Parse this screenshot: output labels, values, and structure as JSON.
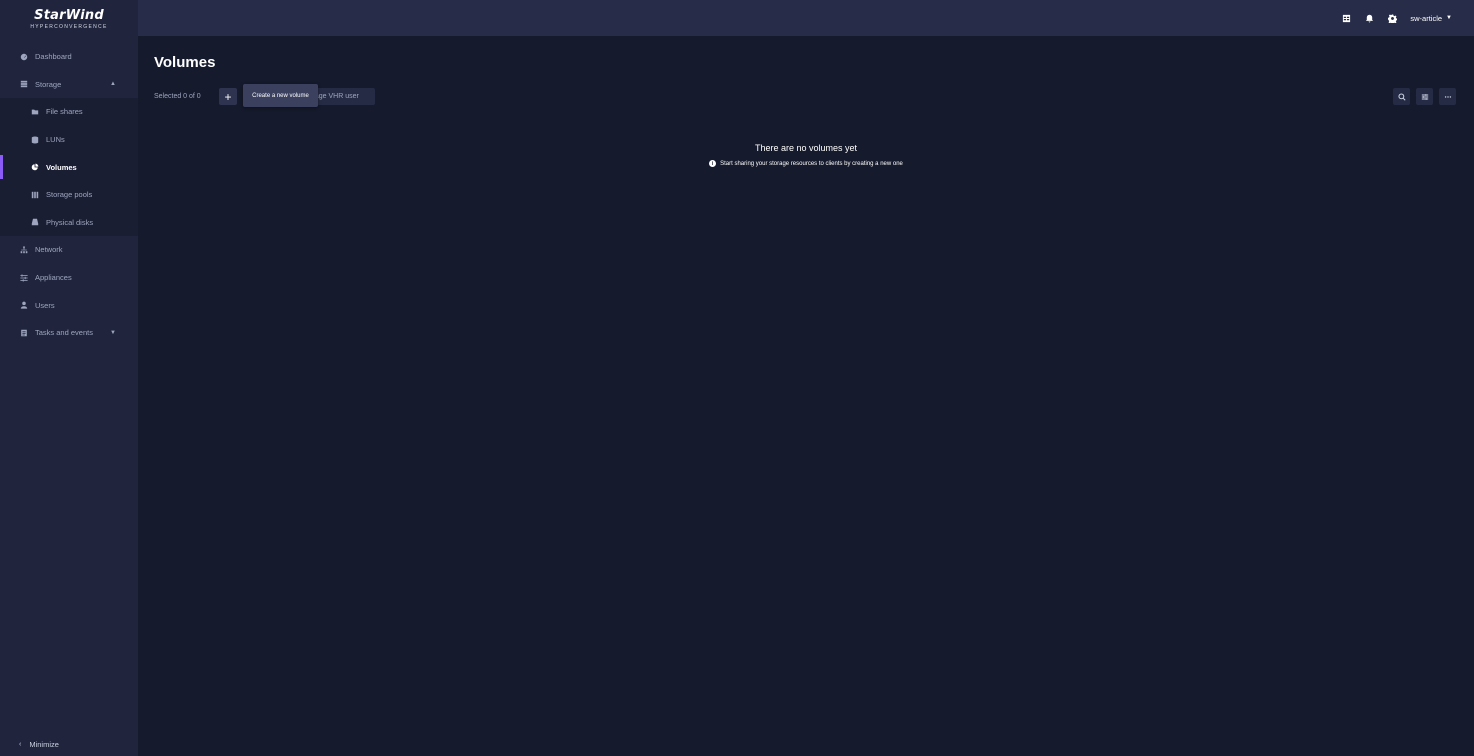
{
  "app": {
    "logo_main": "StarWind",
    "logo_sub": "HYPERCONVERGENCE"
  },
  "sidebar": {
    "items": [
      {
        "label": "Dashboard",
        "icon": "dashboard-icon"
      },
      {
        "label": "Storage",
        "icon": "database-icon",
        "expanded": true
      },
      {
        "label": "Network",
        "icon": "network-icon"
      },
      {
        "label": "Appliances",
        "icon": "appliances-icon"
      },
      {
        "label": "Users",
        "icon": "user-icon"
      },
      {
        "label": "Tasks and events",
        "icon": "tasks-icon"
      }
    ],
    "storage_children": [
      {
        "label": "File shares",
        "icon": "folder-icon"
      },
      {
        "label": "LUNs",
        "icon": "lun-icon"
      },
      {
        "label": "Volumes",
        "icon": "pie-chart-icon",
        "active": true
      },
      {
        "label": "Storage pools",
        "icon": "storage-pool-icon"
      },
      {
        "label": "Physical disks",
        "icon": "disk-icon"
      }
    ],
    "minimize_label": "Minimize"
  },
  "topbar": {
    "username": "sw-article",
    "icons": [
      "table-icon",
      "bell-icon",
      "gear-icon"
    ]
  },
  "main": {
    "title": "Volumes",
    "selected_text": "Selected 0 of 0",
    "add_button": "+",
    "tooltip": "Create a new volume",
    "vhr_button": "nage VHR user",
    "empty_title": "There are no volumes yet",
    "empty_subtitle": "Start sharing your storage resources to clients by creating a new one"
  },
  "colors": {
    "accent": "#8b5cf6",
    "background": "#151a2c",
    "sidebar": "#20253d",
    "topbar": "#272c48"
  }
}
